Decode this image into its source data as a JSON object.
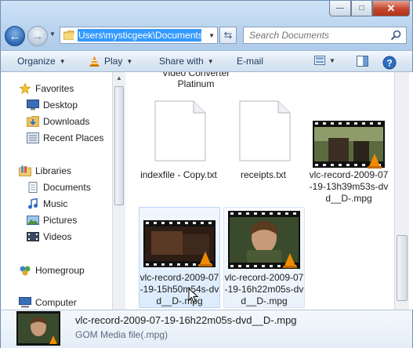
{
  "window": {
    "minimize_glyph": "—",
    "maximize_glyph": "□",
    "close_glyph": "✕"
  },
  "address": {
    "path": "Users\\mysticgeek\\Documents"
  },
  "search": {
    "placeholder": "Search Documents"
  },
  "toolbar": {
    "organize": "Organize",
    "play": "Play",
    "share_with": "Share with",
    "email": "E-mail"
  },
  "nav": {
    "favorites": "Favorites",
    "desktop": "Desktop",
    "downloads": "Downloads",
    "recent_places": "Recent Places",
    "libraries": "Libraries",
    "documents": "Documents",
    "music": "Music",
    "pictures": "Pictures",
    "videos": "Videos",
    "homegroup": "Homegroup",
    "computer": "Computer"
  },
  "files": {
    "clipped_label": "Video Converter\nPlatinum",
    "items": [
      {
        "name": "indexfile - Copy.txt",
        "kind": "text-document"
      },
      {
        "name": "receipts.txt",
        "kind": "text-document"
      },
      {
        "name": "vlc-record-2009-07-19-13h39m53s-dvd__D-.mpg",
        "kind": "video-thumbnail"
      },
      {
        "name": "vlc-record-2009-07-19-15h50m54s-dvd__D-.mpg",
        "kind": "video-thumbnail"
      },
      {
        "name": "vlc-record-2009-07-19-16h22m05s-dvd__D-.mpg",
        "kind": "video-thumbnail"
      }
    ]
  },
  "details": {
    "filename": "vlc-record-2009-07-19-16h22m05s-dvd__D-.mpg",
    "filetype": "GOM Media file(.mpg)"
  },
  "colors": {
    "selection_blue": "#3399ff",
    "vlc_orange": "#f08a00",
    "close_red": "#c4452d"
  }
}
